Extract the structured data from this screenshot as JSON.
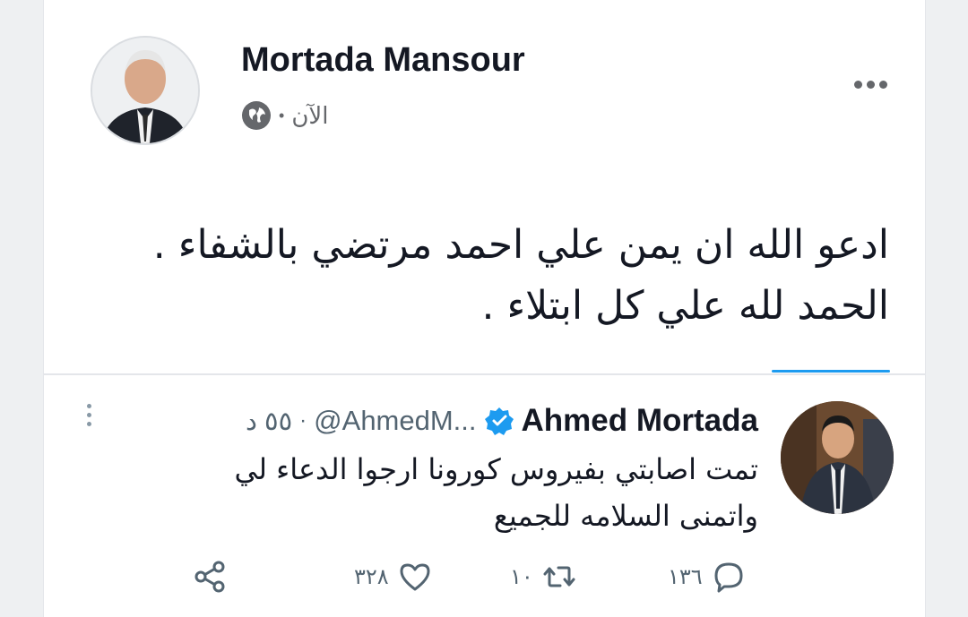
{
  "post": {
    "author": "Mortada Mansour",
    "time": "الآن",
    "separator": "•",
    "text_line1": "ادعو الله ان يمن علي احمد مرتضي بالشفاء .",
    "text_line2": "الحمد لله علي كل ابتلاء ."
  },
  "embedded_tweet": {
    "name": "Ahmed Mortada",
    "handle": "@AhmedM...",
    "separator": "·",
    "time": "٥٥ د",
    "text_line1": "تمت اصابتي بفيروس كورونا ارجوا الدعاء لي",
    "text_line2": "واتمنى السلامه للجميع",
    "replies": "١٣٦",
    "retweets": "١٠",
    "likes": "٣٢٨"
  },
  "colors": {
    "accent": "#1d9bf0",
    "muted": "#536471",
    "text": "#141823"
  },
  "icons": [
    "globe-icon",
    "more-options-icon",
    "verified-badge-icon",
    "reply-icon",
    "retweet-icon",
    "like-icon",
    "share-icon",
    "tweet-menu-icon"
  ]
}
